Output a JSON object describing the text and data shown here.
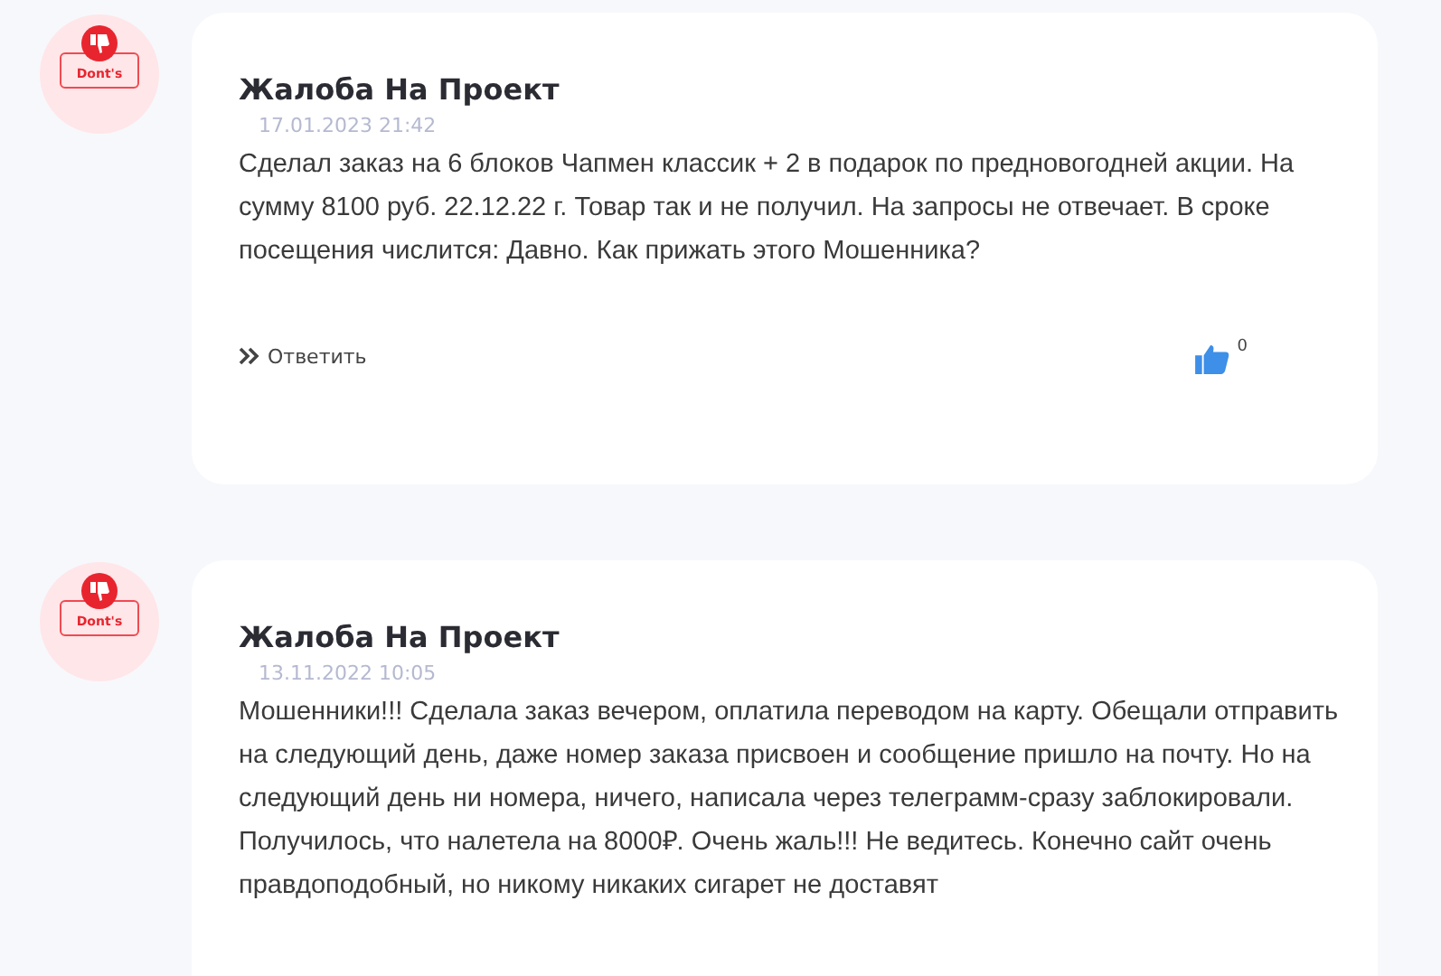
{
  "reviews": [
    {
      "badge": "Dont's",
      "title": "Жалоба На Проект",
      "date": "17.01.2023 21:42",
      "text": "Сделал заказ на 6 блоков Чапмен классик + 2 в подарок по предновогодней акции. На сумму 8100 руб. 22.12.22 г. Товар так и не получил. На запросы не отвечает. В сроке посещения числится: Давно. Как прижать этого Мошенника?",
      "reply": "Ответить",
      "likes": "0"
    },
    {
      "badge": "Dont's",
      "title": "Жалоба На Проект",
      "date": "13.11.2022 10:05",
      "text": "Мошенники!!! Сделала заказ вечером, оплатила переводом на карту. Обещали отправить на следующий день, даже номер заказа присвоен и сообщение пришло на почту. Но на следующий день ни номера, ничего, написала через телеграмм-сразу заблокировали. Получилось, что налетела на 8000₽.  Очень жаль!!! Не ведитесь. Конечно сайт очень правдоподобный, но никому никаких сигарет не доставят"
    }
  ]
}
